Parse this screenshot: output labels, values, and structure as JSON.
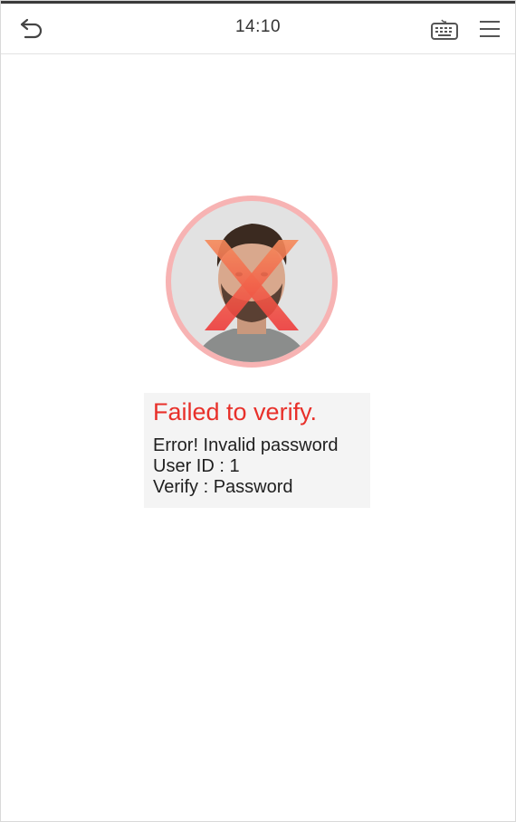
{
  "status_bar": {
    "time": "14:10",
    "back_icon": "back-arrow-icon",
    "keyboard_icon": "keyboard-icon",
    "menu_icon": "hamburger-menu-icon"
  },
  "result": {
    "title": "Failed to verify.",
    "error": "Error! Invalid password",
    "user_id": "User ID : 1",
    "verify_mode": "Verify : Password"
  },
  "colors": {
    "error_red": "#e8302a",
    "ring_pink": "#f6a3a3",
    "panel_gray": "#f4f4f4"
  }
}
